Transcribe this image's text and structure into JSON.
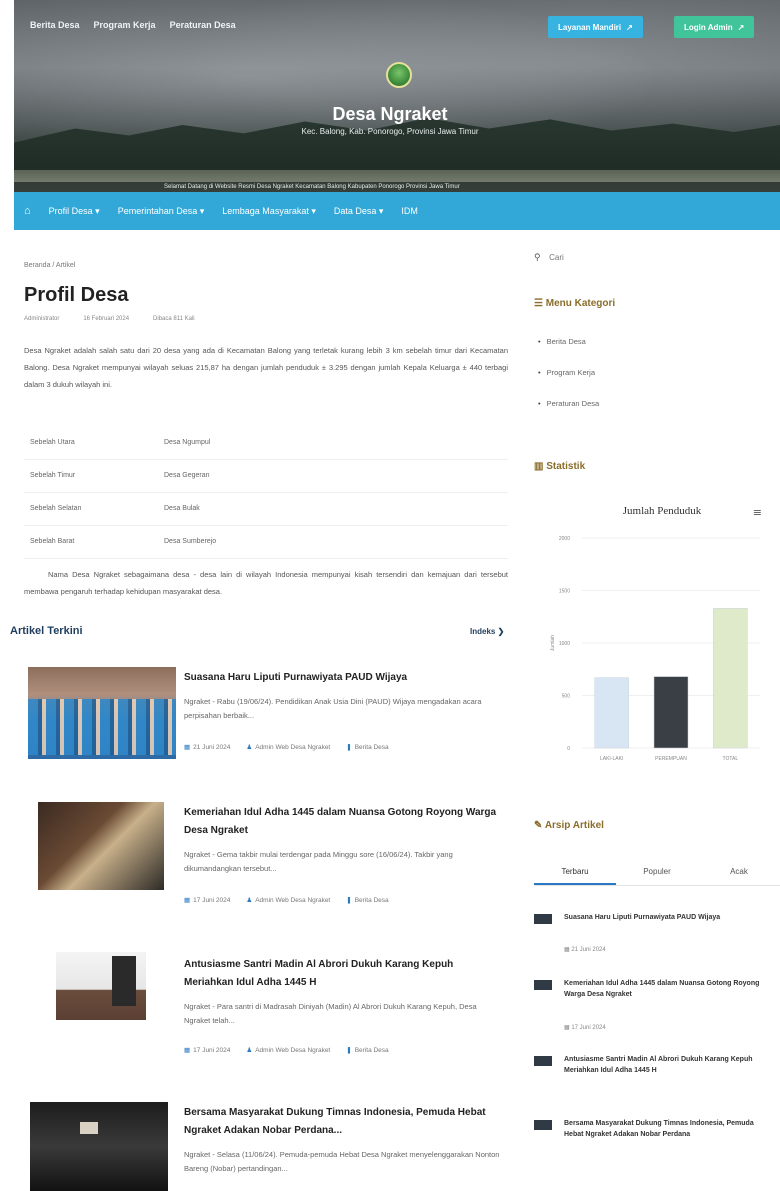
{
  "header": {
    "top_links": [
      "Berita Desa",
      "Program Kerja",
      "Peraturan Desa"
    ],
    "btn_layanan": "Layanan Mandiri",
    "btn_login": "Login Admin",
    "site_title": "Desa Ngraket",
    "site_subtitle": "Kec. Balong, Kab. Ponorogo, Provinsi Jawa Timur",
    "ticker": "Selamat Datang di Website Resmi Desa Ngraket Kecamatan Balong Kabupaten Ponorogo Provinsi Jawa Timur"
  },
  "main_nav": [
    "Profil Desa",
    "Pemerintahan Desa",
    "Lembaga Masyarakat",
    "Data Desa",
    "IDM"
  ],
  "breadcrumb": "Beranda / Artikel",
  "page_title": "Profil Desa",
  "meta": {
    "author": "Administrator",
    "date": "16 Februari 2024",
    "views": "Dibaca 811 Kali"
  },
  "intro_paragraph": "Desa Ngraket adalah salah satu dari 20 desa yang ada di Kecamatan Balong yang terletak kurang lebih 3 km sebelah timur dari Kecamatan Balong. Desa Ngraket mempunyai wilayah seluas 215,87 ha dengan jumlah penduduk ± 3.295 dengan jumlah Kepala Keluarga ± 440 terbagi dalam 3 dukuh wilayah ini.",
  "borders": [
    {
      "side": "Sebelah Utara",
      "village": "Desa Ngumpul"
    },
    {
      "side": "Sebelah Timur",
      "village": "Desa Gegeran"
    },
    {
      "side": "Sebelah Selatan",
      "village": "Desa Bulak"
    },
    {
      "side": "Sebelah Barat",
      "village": "Desa Sumberejo"
    }
  ],
  "second_paragraph": "Nama Desa Ngraket sebagaimana desa - desa lain di wilayah Indonesia mempunyai kisah tersendiri dan kemajuan dari tersebut membawa pengaruh terhadap kehidupan masyarakat desa.",
  "articles_section": {
    "title": "Artikel Terkini",
    "more": "Indeks"
  },
  "articles": [
    {
      "title": "Suasana Haru Liputi Purnawiyata PAUD Wijaya",
      "excerpt": "Ngraket - Rabu (19/06/24). Pendidikan Anak Usia Dini (PAUD) Wijaya mengadakan acara perpisahan berbaik...",
      "date": "21 Juni 2024",
      "author": "Admin Web Desa Ngraket",
      "category": "Berita Desa"
    },
    {
      "title": "Kemeriahan Idul Adha 1445 dalam Nuansa Gotong Royong Warga Desa Ngraket",
      "excerpt": "Ngraket - Gema takbir mulai terdengar pada Minggu sore (16/06/24). Takbir yang dikumandangkan tersebut...",
      "date": "17 Juni 2024",
      "author": "Admin Web Desa Ngraket",
      "category": "Berita Desa"
    },
    {
      "title": "Antusiasme Santri Madin Al Abrori Dukuh Karang Kepuh Meriahkan Idul Adha 1445 H",
      "excerpt": "Ngraket - Para santri di Madrasah Diniyah (Madin) Al Abrori Dukuh Karang Kepuh, Desa Ngraket telah...",
      "date": "17 Juni 2024",
      "author": "Admin Web Desa Ngraket",
      "category": "Berita Desa"
    },
    {
      "title": "Bersama Masyarakat Dukung Timnas Indonesia, Pemuda Hebat Ngraket Adakan Nobar Perdana...",
      "excerpt": "Ngraket - Selasa (11/06/24). Pemuda-pemuda Hebat Desa Ngraket menyelenggarakan Nonton Bareng (Nobar) pertandingan...",
      "date": "",
      "author": "",
      "category": ""
    }
  ],
  "sidebar": {
    "search_placeholder": "Cari",
    "menu_title": "Menu Kategori",
    "menu_items": [
      "Berita Desa",
      "Program Kerja",
      "Peraturan Desa"
    ],
    "stats_title": "Statistik",
    "archive_title": "Arsip Artikel",
    "archive_tabs": [
      "Terbaru",
      "Populer",
      "Acak"
    ],
    "archive_items": [
      {
        "title": "Suasana Haru Liputi Purnawiyata PAUD Wijaya",
        "date": "21 Juni 2024"
      },
      {
        "title": "Kemeriahan Idul Adha 1445 dalam Nuansa Gotong Royong Warga Desa Ngraket",
        "date": "17 Juni 2024"
      },
      {
        "title": "Antusiasme Santri Madin Al Abrori Dukuh Karang Kepuh Meriahkan Idul Adha 1445 H",
        "date": ""
      },
      {
        "title": "Bersama Masyarakat Dukung Timnas Indonesia, Pemuda Hebat Ngraket Adakan Nobar Perdana",
        "date": ""
      }
    ]
  },
  "colors": {
    "nav_blue": "#31a8d8",
    "btn_green": "#42c49a",
    "heading_navy": "#1f3d5c",
    "sidebar_gold": "#8a6d2b"
  },
  "chart_data": {
    "type": "bar",
    "title": "Jumlah Penduduk",
    "ylabel": "Jumlah",
    "ylim": [
      0,
      2000
    ],
    "yticks": [
      0,
      500,
      1000,
      1500,
      2000
    ],
    "categories": [
      "LAKI-LAKI",
      "PEREMPUAN",
      "TOTAL"
    ],
    "values": [
      670,
      680,
      1330
    ],
    "bar_colors": [
      "#d7e6f2",
      "#3a3f45",
      "#dfeacb"
    ]
  }
}
